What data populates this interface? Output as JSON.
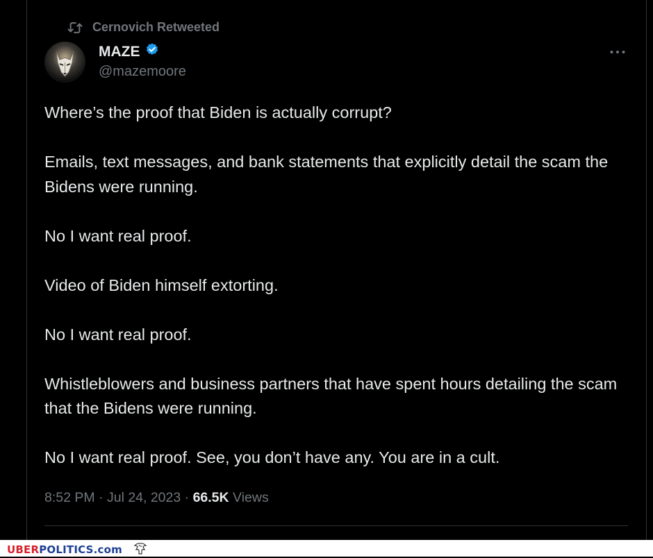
{
  "retweet": {
    "icon": "retweet-icon",
    "label": "Cernovich Retweeted"
  },
  "author": {
    "name": "MAZE",
    "handle": "@mazemoore",
    "verified": true,
    "verified_color": "#1d9bf0",
    "avatar": "wolf-avatar"
  },
  "more_icon": "more-horizontal-icon",
  "tweet": {
    "paragraphs": [
      "Where’s the proof that Biden is actually corrupt?",
      "Emails, text messages, and bank statements that explicitly detail the scam the Bidens were running.",
      "No I want real proof.",
      "Video of Biden himself extorting.",
      "No I want real proof.",
      "Whistleblowers and business partners that have spent hours detailing the scam that the Bidens were running.",
      "No I want real proof. See, you don’t have any. You are in a cult."
    ]
  },
  "meta": {
    "time": "8:52 PM",
    "separator": " · ",
    "date": "Jul 24, 2023",
    "views_count": "66.5K",
    "views_label": " Views"
  },
  "watermark": {
    "uber": "UBER",
    "politics": "POLITICS",
    "com": ".com",
    "logo_icon": "eagle-icon",
    "colors": {
      "uber": "#d6202a",
      "politics": "#1c3f94"
    }
  },
  "colors": {
    "background": "#000000",
    "text": "#e7e9ea",
    "secondary_text": "#71767b",
    "border": "#2f3336"
  }
}
